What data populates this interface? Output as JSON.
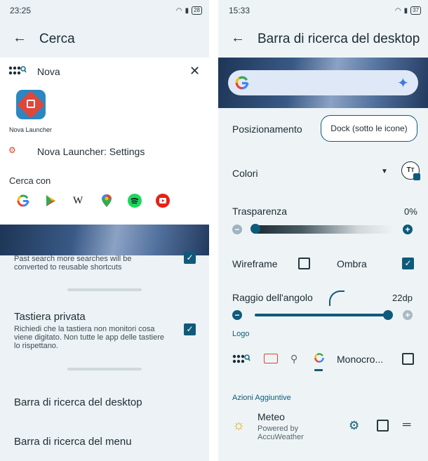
{
  "left": {
    "status": {
      "time": "23:25",
      "battery": "28"
    },
    "header": {
      "title": "Cerca"
    },
    "search": {
      "query": "Nova",
      "app_result": "Nova Launcher",
      "settings_result": "Nova Launcher: Settings",
      "search_with_label": "Cerca con",
      "providers": [
        "G",
        "Play",
        "W",
        "Maps",
        "Spotify",
        "YouTube"
      ]
    },
    "behind_text": "Past search more searches will be converted to reusable shortcuts",
    "private_keyboard": {
      "title": "Tastiera privata",
      "desc": "Richiedi che la tastiera non monitori cosa viene digitato. Non tutte le app delle tastiere lo rispettano."
    },
    "items": [
      "Barra di ricerca del desktop",
      "Barra di ricerca del menu"
    ]
  },
  "right": {
    "status": {
      "time": "15:33",
      "battery": "37"
    },
    "header": {
      "title": "Barra di ricerca del desktop"
    },
    "positioning": {
      "label": "Posizionamento",
      "value": "Dock (sotto le icone)"
    },
    "colors_label": "Colori",
    "transparency": {
      "label": "Trasparenza",
      "value": "0%",
      "fraction": 0.0
    },
    "wireframe_label": "Wireframe",
    "shadow_label": "Ombra",
    "corner": {
      "label": "Raggio dell'angolo",
      "value": "22dp",
      "fraction": 1.0
    },
    "logo_label": "Logo",
    "mono_label": "Monocro...",
    "extra_actions_label": "Azioni Aggiuntive",
    "weather": {
      "title": "Meteo",
      "sub1": "Powered by",
      "sub2": "AccuWeather"
    }
  },
  "colors": {
    "accent": "#0f5a7a",
    "header_bg": "#ecf2f5",
    "slider_active": "#0f5a7a",
    "slider_inactive": "#c9d4da"
  }
}
